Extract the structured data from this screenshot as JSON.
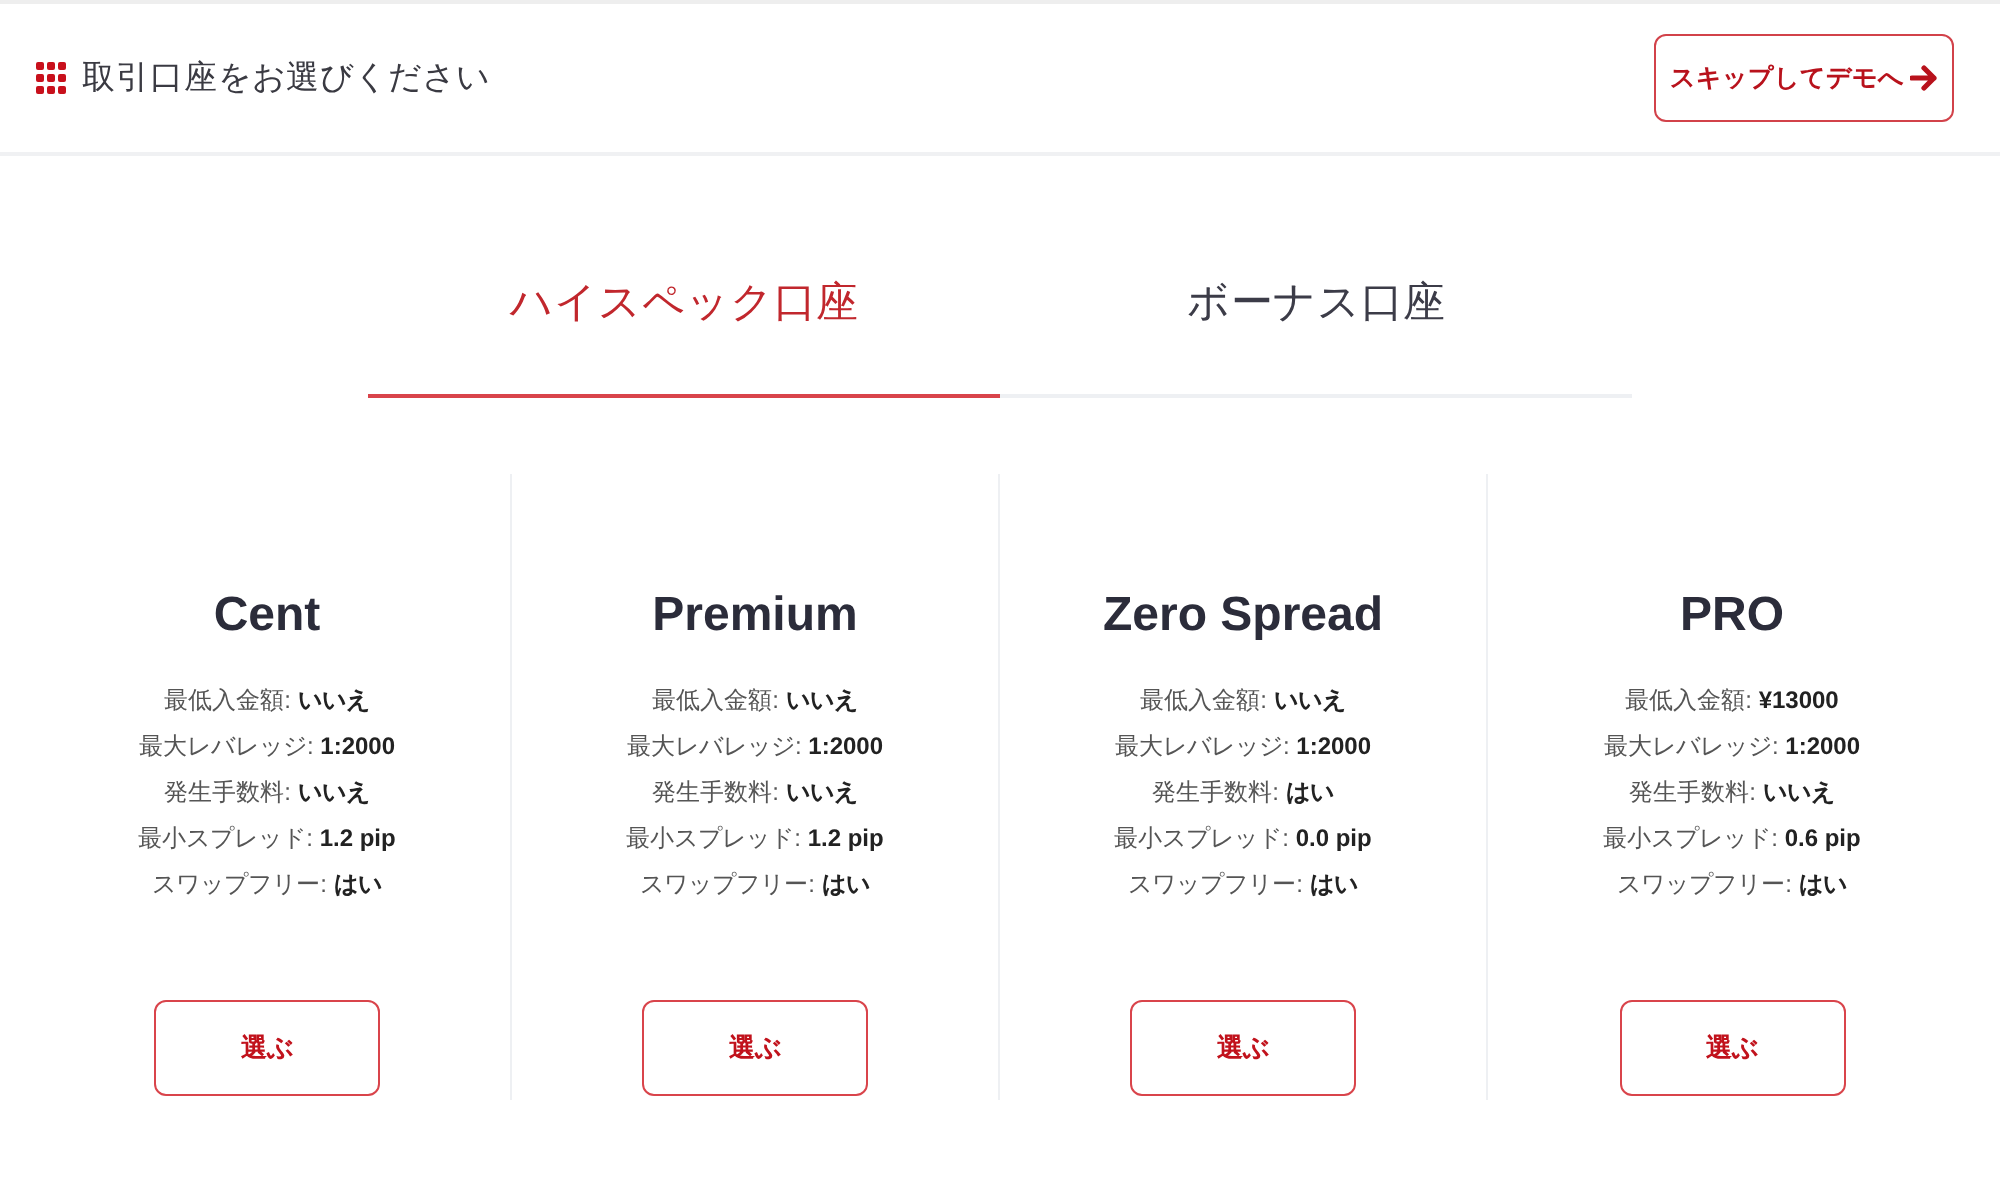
{
  "header": {
    "title": "取引口座をお選びください",
    "skip_button": "スキップしてデモへ"
  },
  "tabs": [
    {
      "label": "ハイスペック口座",
      "selected": true
    },
    {
      "label": "ボーナス口座",
      "selected": false
    }
  ],
  "accounts": [
    {
      "name": "Cent",
      "specs": [
        {
          "label": "最低入金額:",
          "value": "いいえ"
        },
        {
          "label": "最大レバレッジ:",
          "value": "1:2000"
        },
        {
          "label": "発生手数料:",
          "value": "いいえ"
        },
        {
          "label": "最小スプレッド:",
          "value": "1.2 pip"
        },
        {
          "label": "スワップフリー:",
          "value": "はい"
        }
      ],
      "button": "選ぶ"
    },
    {
      "name": "Premium",
      "specs": [
        {
          "label": "最低入金額:",
          "value": "いいえ"
        },
        {
          "label": "最大レバレッジ:",
          "value": "1:2000"
        },
        {
          "label": "発生手数料:",
          "value": "いいえ"
        },
        {
          "label": "最小スプレッド:",
          "value": "1.2 pip"
        },
        {
          "label": "スワップフリー:",
          "value": "はい"
        }
      ],
      "button": "選ぶ"
    },
    {
      "name": "Zero Spread",
      "specs": [
        {
          "label": "最低入金額:",
          "value": "いいえ"
        },
        {
          "label": "最大レバレッジ:",
          "value": "1:2000"
        },
        {
          "label": "発生手数料:",
          "value": "はい"
        },
        {
          "label": "最小スプレッド:",
          "value": "0.0 pip"
        },
        {
          "label": "スワップフリー:",
          "value": "はい"
        }
      ],
      "button": "選ぶ"
    },
    {
      "name": "PRO",
      "specs": [
        {
          "label": "最低入金額:",
          "value": "¥13000"
        },
        {
          "label": "最大レバレッジ:",
          "value": "1:2000"
        },
        {
          "label": "発生手数料:",
          "value": "いいえ"
        },
        {
          "label": "最小スプレッド:",
          "value": "0.6 pip"
        },
        {
          "label": "スワップフリー:",
          "value": "はい"
        }
      ],
      "button": "選ぶ"
    }
  ]
}
